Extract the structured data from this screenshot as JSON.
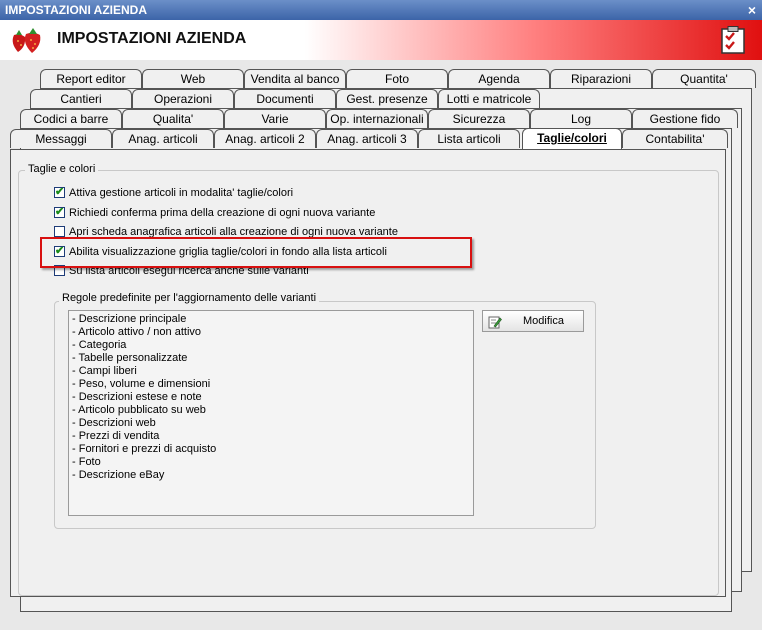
{
  "window": {
    "title": "IMPOSTAZIONI AZIENDA",
    "close_glyph": "×",
    "header_title": "IMPOSTAZIONI AZIENDA",
    "logo_icon": "strawberry-logo-icon",
    "check_icon": "checklist-icon"
  },
  "tabs": {
    "row1": [
      "Report editor",
      "Web",
      "Vendita al banco",
      "Foto",
      "Agenda",
      "Riparazioni",
      "Quantita'"
    ],
    "row2": [
      "Cantieri",
      "Operazioni",
      "Documenti",
      "Gest. presenze",
      "Lotti e matricole"
    ],
    "row3": [
      "Codici a barre",
      "Qualita'",
      "Varie",
      "Op. internazionali",
      "Sicurezza",
      "Log",
      "Gestione fido"
    ],
    "row4": [
      "Messaggi",
      "Anag. articoli",
      "Anag. articoli 2",
      "Anag. articoli 3",
      "Lista articoli",
      "Taglie/colori",
      "Contabilita'"
    ],
    "active": "Taglie/colori"
  },
  "section": {
    "title": "Taglie e colori",
    "checkboxes": [
      {
        "label": "Attiva gestione articoli in modalita' taglie/colori",
        "checked": true
      },
      {
        "label": "Richiedi conferma prima della creazione di ogni nuova variante",
        "checked": true
      },
      {
        "label": "Apri scheda anagrafica articoli alla creazione di ogni nuova variante",
        "checked": false
      },
      {
        "label": "Abilita visualizzazione griglia taglie/colori in fondo alla lista articoli",
        "checked": true
      },
      {
        "label": "Su lista articoli esegui ricerca anche sulle varianti",
        "checked": false
      }
    ]
  },
  "rules": {
    "title": "Regole predefinite per l'aggiornamento delle varianti",
    "items": [
      "- Descrizione principale",
      "- Articolo attivo / non attivo",
      "- Categoria",
      "- Tabelle personalizzate",
      "- Campi liberi",
      "- Peso, volume e dimensioni",
      "- Descrizioni estese e note",
      "- Articolo pubblicato su web",
      "- Descrizioni web",
      "- Prezzi di vendita",
      "- Fornitori e prezzi di acquisto",
      "- Foto",
      "- Descrizione eBay"
    ],
    "button_label": "Modifica",
    "button_icon": "edit-pencil-icon"
  },
  "colors": {
    "highlight": "#d81010",
    "title_bar": "#3c64a8",
    "check": "#1a8a1a"
  }
}
